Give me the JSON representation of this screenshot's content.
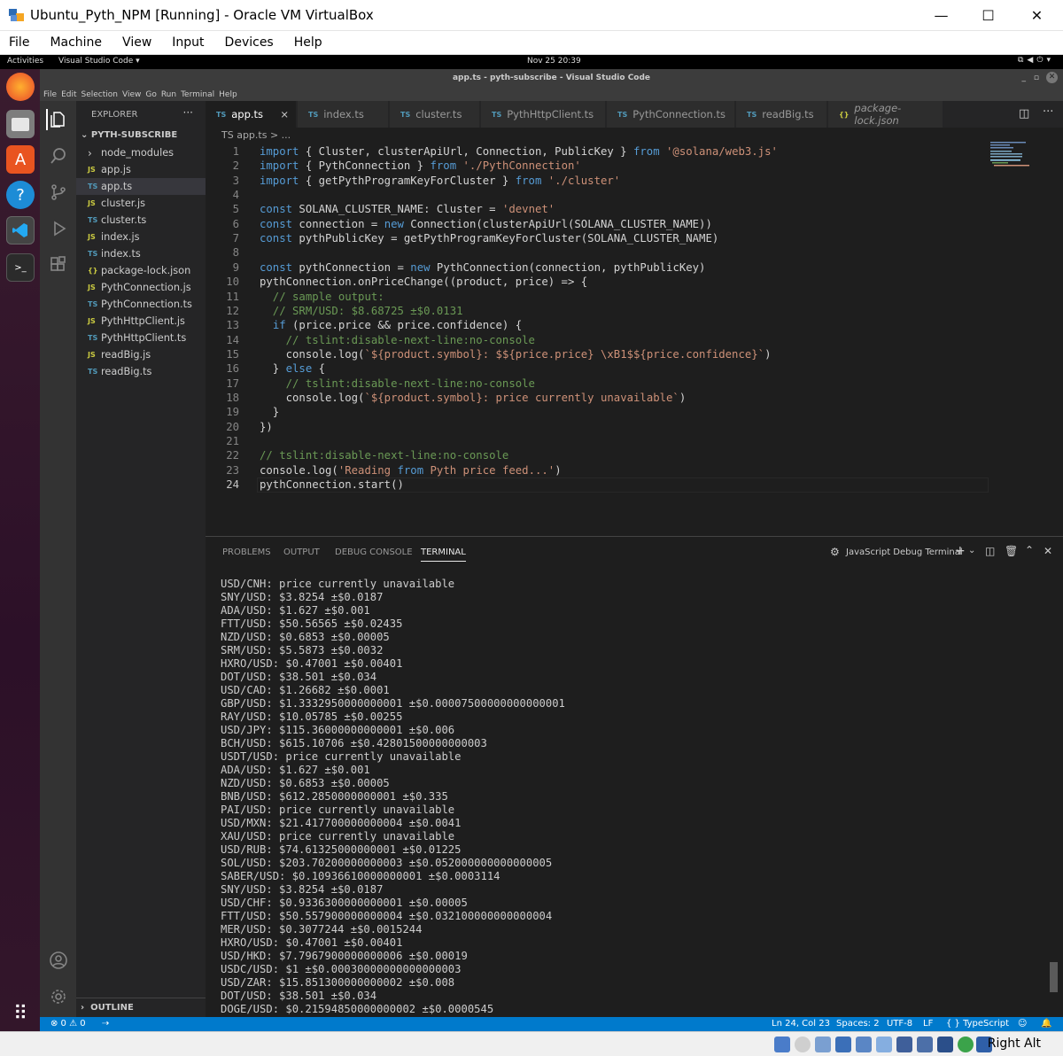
{
  "vbox": {
    "title": "Ubuntu_Pyth_NPM [Running] - Oracle VM VirtualBox",
    "menu": [
      "File",
      "Machine",
      "View",
      "Input",
      "Devices",
      "Help"
    ],
    "host_key": "Right Alt"
  },
  "gnome": {
    "activities": "Activities",
    "app": "Visual Studio Code ▾",
    "clock": "Nov 25  20:39"
  },
  "vscode": {
    "title": "app.ts - pyth-subscribe - Visual Studio Code",
    "menu": [
      "File",
      "Edit",
      "Selection",
      "View",
      "Go",
      "Run",
      "Terminal",
      "Help"
    ],
    "explorer": {
      "header": "EXPLORER",
      "section": "PYTH-SUBSCRIBE",
      "outline": "OUTLINE",
      "files": [
        {
          "icon": "›",
          "name": "node_modules",
          "kind": "folder"
        },
        {
          "icon": "JS",
          "name": "app.js",
          "kind": "js"
        },
        {
          "icon": "TS",
          "name": "app.ts",
          "kind": "ts",
          "selected": true
        },
        {
          "icon": "JS",
          "name": "cluster.js",
          "kind": "js"
        },
        {
          "icon": "TS",
          "name": "cluster.ts",
          "kind": "ts"
        },
        {
          "icon": "JS",
          "name": "index.js",
          "kind": "js"
        },
        {
          "icon": "TS",
          "name": "index.ts",
          "kind": "ts"
        },
        {
          "icon": "{}",
          "name": "package-lock.json",
          "kind": "json"
        },
        {
          "icon": "JS",
          "name": "PythConnection.js",
          "kind": "js"
        },
        {
          "icon": "TS",
          "name": "PythConnection.ts",
          "kind": "ts"
        },
        {
          "icon": "JS",
          "name": "PythHttpClient.js",
          "kind": "js"
        },
        {
          "icon": "TS",
          "name": "PythHttpClient.ts",
          "kind": "ts"
        },
        {
          "icon": "JS",
          "name": "readBig.js",
          "kind": "js"
        },
        {
          "icon": "TS",
          "name": "readBig.ts",
          "kind": "ts"
        }
      ]
    },
    "tabs": [
      {
        "icon": "TS",
        "label": "app.ts",
        "active": true,
        "close": "×"
      },
      {
        "icon": "TS",
        "label": "index.ts"
      },
      {
        "icon": "TS",
        "label": "cluster.ts"
      },
      {
        "icon": "TS",
        "label": "PythHttpClient.ts"
      },
      {
        "icon": "TS",
        "label": "PythConnection.ts"
      },
      {
        "icon": "TS",
        "label": "readBig.ts"
      },
      {
        "icon": "{}",
        "label": "package-lock.json",
        "italic": true
      }
    ],
    "breadcrumb": "TS app.ts > ...",
    "code": [
      "import { Cluster, clusterApiUrl, Connection, PublicKey } from '@solana/web3.js'",
      "import { PythConnection } from './PythConnection'",
      "import { getPythProgramKeyForCluster } from './cluster'",
      "",
      "const SOLANA_CLUSTER_NAME: Cluster = 'devnet'",
      "const connection = new Connection(clusterApiUrl(SOLANA_CLUSTER_NAME))",
      "const pythPublicKey = getPythProgramKeyForCluster(SOLANA_CLUSTER_NAME)",
      "",
      "const pythConnection = new PythConnection(connection, pythPublicKey)",
      "pythConnection.onPriceChange((product, price) => {",
      "  // sample output:",
      "  // SRM/USD: $8.68725 ±$0.0131",
      "  if (price.price && price.confidence) {",
      "    // tslint:disable-next-line:no-console",
      "    console.log(`${product.symbol}: $${price.price} \\xB1$${price.confidence}`)",
      "  } else {",
      "    // tslint:disable-next-line:no-console",
      "    console.log(`${product.symbol}: price currently unavailable`)",
      "  }",
      "})",
      "",
      "// tslint:disable-next-line:no-console",
      "console.log('Reading from Pyth price feed...')",
      "pythConnection.start()"
    ],
    "panel": {
      "tabs": [
        "PROBLEMS",
        "OUTPUT",
        "DEBUG CONSOLE",
        "TERMINAL"
      ],
      "terminal_name": "JavaScript Debug Terminal",
      "lines": [
        "USD/CNH: price currently unavailable",
        "SNY/USD: $3.8254 ±$0.0187",
        "ADA/USD: $1.627 ±$0.001",
        "FTT/USD: $50.56565 ±$0.02435",
        "NZD/USD: $0.6853 ±$0.00005",
        "SRM/USD: $5.5873 ±$0.0032",
        "HXRO/USD: $0.47001 ±$0.00401",
        "DOT/USD: $38.501 ±$0.034",
        "USD/CAD: $1.26682 ±$0.0001",
        "GBP/USD: $1.3332950000000001 ±$0.00007500000000000001",
        "RAY/USD: $10.05785 ±$0.00255",
        "USD/JPY: $115.36000000000001 ±$0.006",
        "BCH/USD: $615.10706 ±$0.42801500000000003",
        "USDT/USD: price currently unavailable",
        "ADA/USD: $1.627 ±$0.001",
        "NZD/USD: $0.6853 ±$0.00005",
        "BNB/USD: $612.2850000000001 ±$0.335",
        "PAI/USD: price currently unavailable",
        "USD/MXN: $21.417700000000004 ±$0.0041",
        "XAU/USD: price currently unavailable",
        "USD/RUB: $74.61325000000001 ±$0.01225",
        "SOL/USD: $203.70200000000003 ±$0.052000000000000005",
        "SABER/USD: $0.10936610000000001 ±$0.0003114",
        "SNY/USD: $3.8254 ±$0.0187",
        "USD/CHF: $0.9336300000000001 ±$0.00005",
        "FTT/USD: $50.557900000000004 ±$0.032100000000000004",
        "MER/USD: $0.3077244 ±$0.0015244",
        "HXRO/USD: $0.47001 ±$0.00401",
        "USD/HKD: $7.7967900000000006 ±$0.00019",
        "USDC/USD: $1 ±$0.00030000000000000003",
        "USD/ZAR: $15.851300000000002 ±$0.008",
        "DOT/USD: $38.501 ±$0.034",
        "DOGE/USD: $0.21594850000000002 ±$0.0000545"
      ]
    },
    "status": {
      "errors": "⊗ 0 ⚠ 0",
      "position": "Ln 24, Col 23",
      "spaces": "Spaces: 2",
      "encoding": "UTF-8",
      "eol": "LF",
      "language": "{ } TypeScript"
    }
  }
}
